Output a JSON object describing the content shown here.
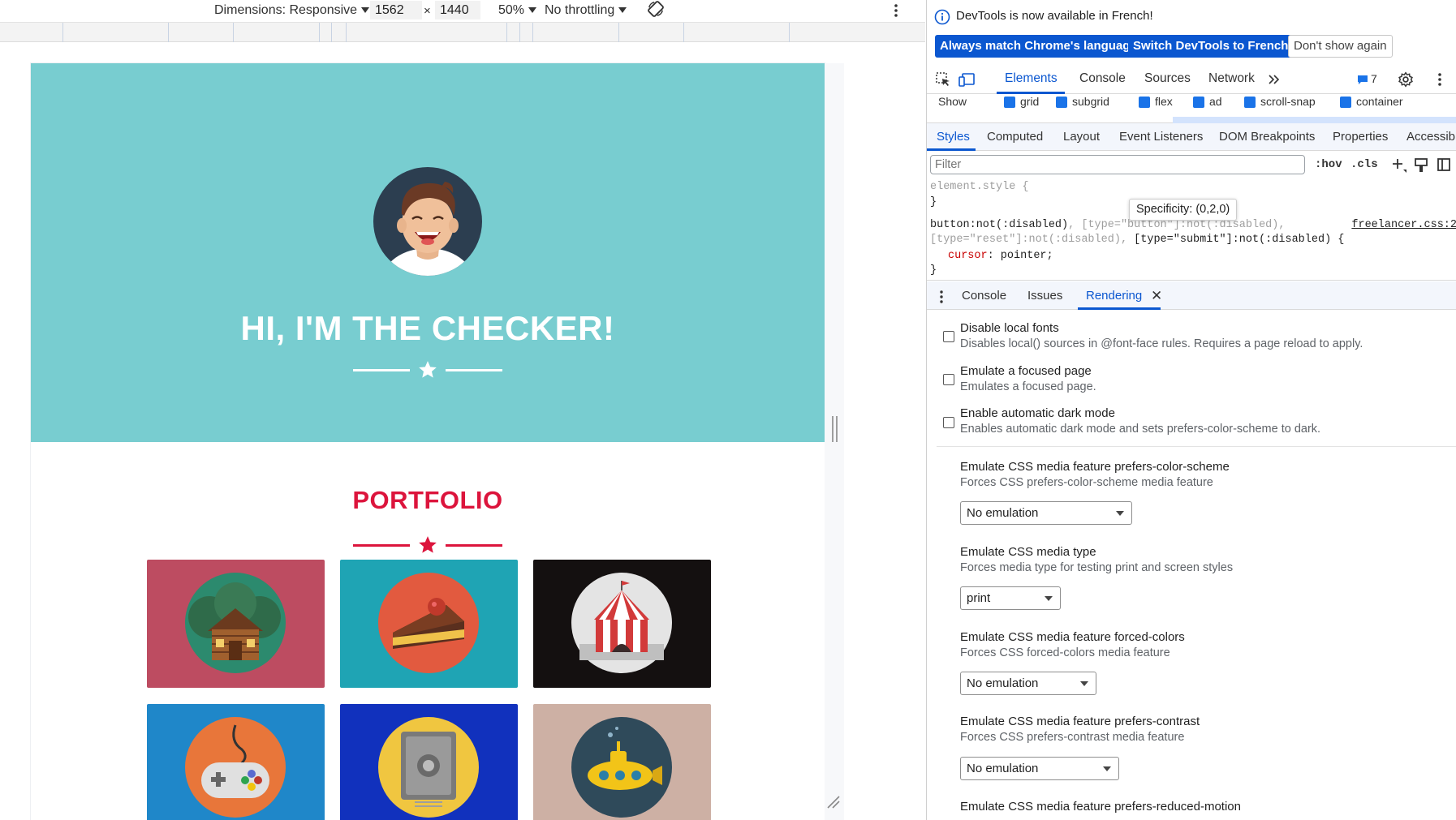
{
  "device_toolbar": {
    "dimensions_label": "Dimensions: Responsive",
    "width_value": "1562",
    "times": "×",
    "height_value": "1440",
    "zoom": "50%",
    "throttling": "No throttling"
  },
  "page": {
    "hero_title": "HI, I'M THE CHECKER!",
    "portfolio_title": "PORTFOLIO",
    "colors": {
      "hero": "#78cdd0",
      "accent": "#dc143c",
      "tiles": [
        "#bd4c61",
        "#1fa4b4",
        "#141010",
        "#1f87c9",
        "#1131bd",
        "#cdb0a4"
      ]
    }
  },
  "devtools": {
    "infobar": {
      "message": "DevTools is now available in French!",
      "btn_match": "Always match Chrome's language",
      "btn_switch": "Switch DevTools to French",
      "btn_dismiss": "Don't show again"
    },
    "main_tabs": [
      "Elements",
      "Console",
      "Sources",
      "Network"
    ],
    "issues_count": "7",
    "show_row": {
      "label": "Show",
      "options": [
        "grid",
        "subgrid",
        "flex",
        "ad",
        "scroll-snap",
        "container"
      ]
    },
    "style_tabs": [
      "Styles",
      "Computed",
      "Layout",
      "Event Listeners",
      "DOM Breakpoints",
      "Properties",
      "Accessibi"
    ],
    "filter_placeholder": "Filter",
    "filter_hov": ":hov",
    "filter_cls": ".cls",
    "css": {
      "element_style": "element.style {",
      "close_brace": "}",
      "sel_active_1": "button:not(:disabled)",
      "sel_dim_1": ", [type=\"button\"]:not(:disabled),",
      "sel_dim_2": "[type=\"reset\"]:not(:disabled),",
      "sel_active_2": " [type=\"submit\"]:not(:disabled) {",
      "prop_name": "cursor",
      "prop_value": ": pointer;",
      "source": "freelancer.css:2",
      "tooltip": "Specificity: (0,2,0)"
    },
    "drawer_tabs": [
      "Console",
      "Issues",
      "Rendering"
    ],
    "rendering": {
      "checkboxes": [
        {
          "title": "Disable local fonts",
          "desc": "Disables local() sources in @font-face rules. Requires a page reload to apply."
        },
        {
          "title": "Emulate a focused page",
          "desc": "Emulates a focused page."
        },
        {
          "title": "Enable automatic dark mode",
          "desc": "Enables automatic dark mode and sets prefers-color-scheme to dark."
        }
      ],
      "selects": [
        {
          "title": "Emulate CSS media feature prefers-color-scheme",
          "desc": "Forces CSS prefers-color-scheme media feature",
          "value": "No emulation"
        },
        {
          "title": "Emulate CSS media type",
          "desc": "Forces media type for testing print and screen styles",
          "value": "print"
        },
        {
          "title": "Emulate CSS media feature forced-colors",
          "desc": "Forces CSS forced-colors media feature",
          "value": "No emulation"
        },
        {
          "title": "Emulate CSS media feature prefers-contrast",
          "desc": "Forces CSS prefers-contrast media feature",
          "value": "No emulation"
        },
        {
          "title": "Emulate CSS media feature prefers-reduced-motion",
          "desc": "",
          "value": ""
        }
      ]
    }
  }
}
